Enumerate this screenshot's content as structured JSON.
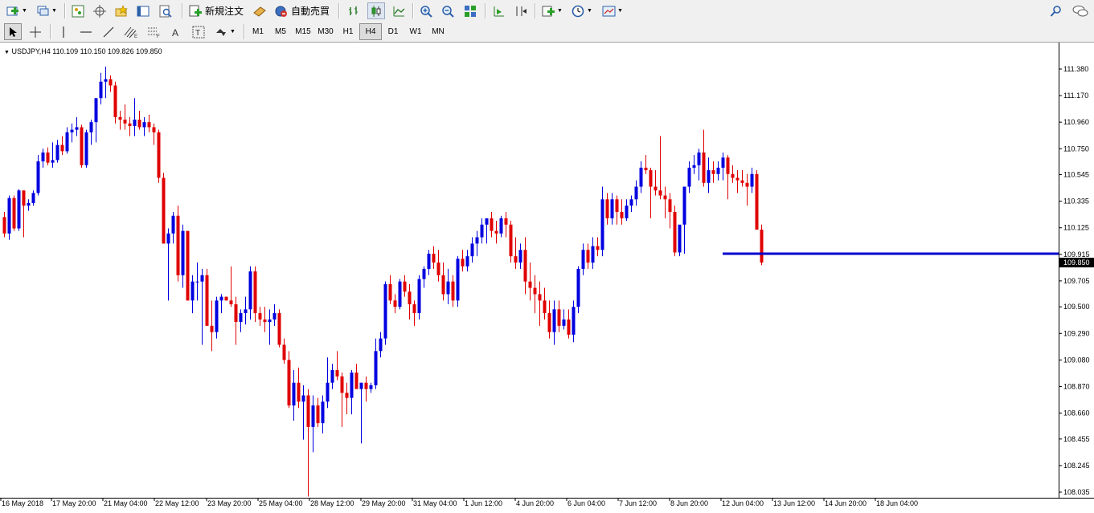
{
  "toolbar": {
    "new_order_label": "新規注文",
    "auto_trade_label": "自動売買"
  },
  "timeframes": [
    {
      "label": "M1"
    },
    {
      "label": "M5"
    },
    {
      "label": "M15"
    },
    {
      "label": "M30"
    },
    {
      "label": "H1"
    },
    {
      "label": "H4",
      "active": true
    },
    {
      "label": "D1"
    },
    {
      "label": "W1"
    },
    {
      "label": "MN"
    }
  ],
  "chart": {
    "symbol_info": "USDJPY,H4  110.109 110.150 109.826 109.850",
    "current_price_label": "109.850"
  },
  "colors": {
    "bull": "#0000e0",
    "bear": "#e00000",
    "hline": "#0000cc",
    "price_tag_bg": "#000000"
  },
  "chart_data": {
    "type": "candlestick",
    "symbol": "USDJPY",
    "timeframe": "H4",
    "ohlc_last": {
      "open": 110.109,
      "high": 110.15,
      "low": 109.826,
      "close": 109.85
    },
    "y_tick_labels": [
      "111.380",
      "111.170",
      "110.960",
      "110.750",
      "110.545",
      "110.335",
      "110.125",
      "109.915",
      "109.705",
      "109.500",
      "109.290",
      "109.080",
      "108.870",
      "108.660",
      "108.455",
      "108.245",
      "108.035"
    ],
    "x_tick_labels": [
      "16 May 2018",
      "17 May 20:00",
      "21 May 04:00",
      "22 May 12:00",
      "23 May 20:00",
      "25 May 04:00",
      "28 May 12:00",
      "29 May 20:00",
      "31 May 04:00",
      "1 Jun 12:00",
      "4 Jun 20:00",
      "6 Jun 04:00",
      "7 Jun 12:00",
      "8 Jun 20:00",
      "12 Jun 04:00",
      "13 Jun 12:00",
      "14 Jun 20:00",
      "18 Jun 04:00"
    ],
    "ylim": [
      108.035,
      111.38
    ],
    "horizontal_line_price": 109.92,
    "horizontal_line_start_index": 149,
    "current_price": 109.85,
    "candles": [
      [
        110.21,
        110.25,
        110.05,
        110.08
      ],
      [
        110.08,
        110.38,
        110.03,
        110.36
      ],
      [
        110.36,
        110.38,
        110.1,
        110.12
      ],
      [
        110.12,
        110.43,
        110.1,
        110.42
      ],
      [
        110.42,
        110.42,
        110.05,
        110.3
      ],
      [
        110.3,
        110.35,
        110.26,
        110.32
      ],
      [
        110.32,
        110.42,
        110.3,
        110.4
      ],
      [
        110.4,
        110.7,
        110.38,
        110.65
      ],
      [
        110.65,
        110.75,
        110.6,
        110.72
      ],
      [
        110.72,
        110.76,
        110.62,
        110.64
      ],
      [
        110.64,
        110.8,
        110.6,
        110.66
      ],
      [
        110.66,
        110.82,
        110.64,
        110.78
      ],
      [
        110.78,
        110.85,
        110.7,
        110.73
      ],
      [
        110.73,
        110.92,
        110.71,
        110.88
      ],
      [
        110.88,
        110.95,
        110.8,
        110.9
      ],
      [
        110.9,
        111.0,
        110.85,
        110.92
      ],
      [
        110.92,
        110.94,
        110.6,
        110.62
      ],
      [
        110.62,
        110.9,
        110.6,
        110.88
      ],
      [
        110.88,
        110.98,
        110.78,
        110.96
      ],
      [
        110.96,
        111.1,
        110.8,
        111.15
      ],
      [
        111.15,
        111.35,
        111.1,
        111.28
      ],
      [
        111.28,
        111.4,
        111.15,
        111.3
      ],
      [
        111.3,
        111.33,
        111.2,
        111.25
      ],
      [
        111.25,
        111.28,
        110.95,
        111.0
      ],
      [
        111.0,
        111.05,
        110.9,
        110.98
      ],
      [
        110.98,
        111.1,
        110.9,
        110.95
      ],
      [
        110.95,
        111.0,
        110.85,
        110.93
      ],
      [
        110.93,
        111.15,
        110.85,
        110.98
      ],
      [
        110.98,
        111.05,
        110.9,
        110.92
      ],
      [
        110.92,
        111.0,
        110.85,
        110.96
      ],
      [
        110.96,
        111.02,
        110.88,
        110.92
      ],
      [
        110.92,
        110.95,
        110.78,
        110.88
      ],
      [
        110.88,
        110.9,
        110.48,
        110.52
      ],
      [
        110.52,
        110.56,
        110.0,
        110.0
      ],
      [
        110.0,
        110.12,
        109.55,
        110.08
      ],
      [
        110.08,
        110.25,
        110.0,
        110.22
      ],
      [
        110.22,
        110.3,
        109.7,
        109.75
      ],
      [
        109.75,
        110.15,
        109.65,
        110.1
      ],
      [
        110.1,
        110.1,
        109.55,
        109.55
      ],
      [
        109.55,
        109.75,
        109.45,
        109.7
      ],
      [
        109.7,
        109.85,
        109.55,
        109.7
      ],
      [
        109.7,
        109.8,
        109.2,
        109.75
      ],
      [
        109.75,
        109.8,
        109.35,
        109.35
      ],
      [
        109.35,
        109.55,
        109.15,
        109.3
      ],
      [
        109.3,
        109.58,
        109.25,
        109.55
      ],
      [
        109.55,
        109.6,
        109.45,
        109.58
      ],
      [
        109.58,
        109.58,
        109.55,
        109.55
      ],
      [
        109.55,
        109.82,
        109.5,
        109.52
      ],
      [
        109.52,
        109.58,
        109.2,
        109.38
      ],
      [
        109.38,
        109.48,
        109.3,
        109.45
      ],
      [
        109.45,
        109.58,
        109.36,
        109.48
      ],
      [
        109.48,
        109.82,
        109.4,
        109.78
      ],
      [
        109.78,
        109.82,
        109.38,
        109.45
      ],
      [
        109.45,
        109.5,
        109.35,
        109.4
      ],
      [
        109.4,
        109.5,
        109.3,
        109.38
      ],
      [
        109.38,
        109.48,
        109.2,
        109.4
      ],
      [
        109.4,
        109.52,
        109.35,
        109.45
      ],
      [
        109.45,
        109.48,
        109.18,
        109.2
      ],
      [
        109.2,
        109.25,
        109.05,
        109.08
      ],
      [
        109.08,
        109.15,
        108.7,
        108.72
      ],
      [
        108.72,
        109.0,
        108.6,
        108.9
      ],
      [
        108.9,
        109.02,
        108.7,
        108.75
      ],
      [
        108.75,
        108.88,
        108.45,
        108.8
      ],
      [
        108.8,
        108.85,
        108.0,
        108.55
      ],
      [
        108.55,
        108.8,
        108.35,
        108.72
      ],
      [
        108.72,
        108.78,
        108.55,
        108.58
      ],
      [
        108.58,
        108.8,
        108.5,
        108.75
      ],
      [
        108.75,
        109.1,
        108.7,
        108.9
      ],
      [
        108.9,
        109.05,
        108.85,
        109.0
      ],
      [
        109.0,
        109.15,
        108.92,
        108.95
      ],
      [
        108.95,
        108.98,
        108.55,
        108.82
      ],
      [
        108.82,
        108.9,
        108.65,
        108.78
      ],
      [
        108.78,
        109.0,
        108.65,
        108.98
      ],
      [
        108.98,
        109.05,
        108.88,
        108.85
      ],
      [
        108.85,
        108.9,
        108.42,
        108.9
      ],
      [
        108.9,
        108.95,
        108.75,
        108.85
      ],
      [
        108.85,
        108.9,
        108.82,
        108.88
      ],
      [
        108.88,
        109.25,
        108.85,
        109.15
      ],
      [
        109.15,
        109.3,
        109.1,
        109.25
      ],
      [
        109.25,
        109.7,
        109.2,
        109.68
      ],
      [
        109.68,
        109.75,
        109.52,
        109.55
      ],
      [
        109.55,
        109.6,
        109.45,
        109.5
      ],
      [
        109.5,
        109.72,
        109.48,
        109.7
      ],
      [
        109.7,
        109.75,
        109.58,
        109.62
      ],
      [
        109.62,
        109.68,
        109.4,
        109.52
      ],
      [
        109.52,
        109.55,
        109.35,
        109.45
      ],
      [
        109.45,
        109.75,
        109.4,
        109.72
      ],
      [
        109.72,
        109.82,
        109.65,
        109.8
      ],
      [
        109.8,
        109.95,
        109.75,
        109.92
      ],
      [
        109.92,
        109.98,
        109.8,
        109.85
      ],
      [
        109.85,
        109.95,
        109.7,
        109.75
      ],
      [
        109.75,
        109.85,
        109.55,
        109.6
      ],
      [
        109.6,
        109.8,
        109.52,
        109.7
      ],
      [
        109.7,
        109.75,
        109.5,
        109.55
      ],
      [
        109.55,
        109.9,
        109.5,
        109.88
      ],
      [
        109.88,
        109.95,
        109.78,
        109.82
      ],
      [
        109.82,
        109.95,
        109.78,
        109.9
      ],
      [
        109.9,
        110.05,
        109.85,
        110.0
      ],
      [
        110.0,
        110.1,
        109.9,
        110.05
      ],
      [
        110.05,
        110.2,
        110.0,
        110.15
      ],
      [
        110.15,
        110.2,
        110.0,
        110.2
      ],
      [
        110.2,
        110.25,
        110.05,
        110.1
      ],
      [
        110.1,
        110.18,
        110.0,
        110.08
      ],
      [
        110.08,
        110.22,
        110.05,
        110.2
      ],
      [
        110.2,
        110.25,
        110.05,
        110.15
      ],
      [
        110.15,
        110.18,
        109.85,
        109.9
      ],
      [
        109.9,
        110.05,
        109.8,
        109.85
      ],
      [
        109.85,
        110.0,
        109.8,
        109.95
      ],
      [
        109.95,
        110.05,
        109.6,
        109.7
      ],
      [
        109.7,
        109.85,
        109.55,
        109.65
      ],
      [
        109.65,
        109.75,
        109.45,
        109.6
      ],
      [
        109.6,
        109.7,
        109.35,
        109.55
      ],
      [
        109.55,
        109.65,
        109.4,
        109.45
      ],
      [
        109.45,
        109.55,
        109.25,
        109.3
      ],
      [
        109.3,
        109.55,
        109.2,
        109.48
      ],
      [
        109.48,
        109.55,
        109.3,
        109.35
      ],
      [
        109.35,
        109.48,
        109.32,
        109.4
      ],
      [
        109.4,
        109.48,
        109.25,
        109.28
      ],
      [
        109.28,
        109.55,
        109.22,
        109.5
      ],
      [
        109.5,
        109.82,
        109.45,
        109.8
      ],
      [
        109.8,
        110.0,
        109.75,
        109.95
      ],
      [
        109.95,
        110.0,
        109.8,
        109.85
      ],
      [
        109.85,
        110.05,
        109.8,
        109.98
      ],
      [
        109.98,
        110.05,
        109.9,
        109.95
      ],
      [
        109.95,
        110.45,
        109.9,
        110.35
      ],
      [
        110.35,
        110.4,
        110.15,
        110.2
      ],
      [
        110.2,
        110.4,
        110.15,
        110.35
      ],
      [
        110.35,
        110.38,
        110.15,
        110.25
      ],
      [
        110.25,
        110.35,
        110.15,
        110.2
      ],
      [
        110.2,
        110.35,
        110.18,
        110.3
      ],
      [
        110.3,
        110.38,
        110.25,
        110.35
      ],
      [
        110.35,
        110.5,
        110.3,
        110.45
      ],
      [
        110.45,
        110.65,
        110.4,
        110.6
      ],
      [
        110.6,
        110.7,
        110.55,
        110.58
      ],
      [
        110.58,
        110.6,
        110.2,
        110.45
      ],
      [
        110.45,
        110.58,
        110.38,
        110.42
      ],
      [
        110.42,
        110.85,
        110.35,
        110.38
      ],
      [
        110.38,
        110.45,
        110.2,
        110.35
      ],
      [
        110.35,
        110.4,
        110.12,
        110.25
      ],
      [
        110.25,
        110.3,
        109.9,
        109.93
      ],
      [
        109.93,
        110.0,
        109.9,
        110.15
      ],
      [
        110.15,
        110.25,
        109.92,
        110.45
      ],
      [
        110.45,
        110.65,
        110.4,
        110.6
      ],
      [
        110.6,
        110.7,
        110.55,
        110.62
      ],
      [
        110.62,
        110.75,
        110.5,
        110.72
      ],
      [
        110.72,
        110.9,
        110.45,
        110.48
      ],
      [
        110.48,
        110.68,
        110.4,
        110.58
      ],
      [
        110.58,
        110.65,
        110.48,
        110.55
      ],
      [
        110.55,
        110.65,
        110.5,
        110.6
      ],
      [
        110.6,
        110.72,
        110.5,
        110.68
      ],
      [
        110.68,
        110.7,
        110.35,
        110.55
      ],
      [
        110.55,
        110.62,
        110.48,
        110.52
      ],
      [
        110.52,
        110.58,
        110.4,
        110.5
      ],
      [
        110.5,
        110.58,
        110.45,
        110.48
      ],
      [
        110.48,
        110.55,
        110.3,
        110.45
      ],
      [
        110.45,
        110.6,
        110.4,
        110.55
      ],
      [
        110.55,
        110.58,
        110.15,
        110.11
      ],
      [
        110.11,
        110.15,
        109.83,
        109.85
      ]
    ]
  }
}
